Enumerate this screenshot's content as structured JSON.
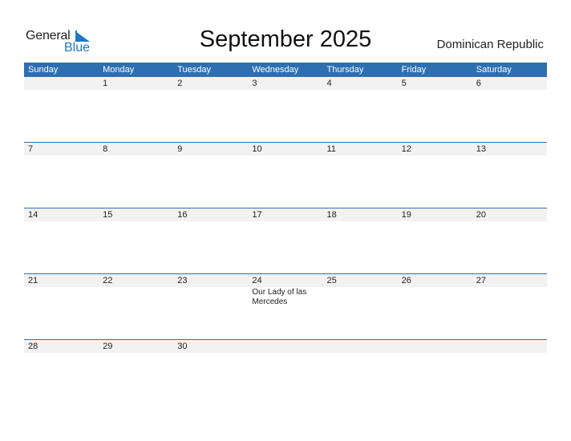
{
  "logo": {
    "word1": "General",
    "word2": "Blue"
  },
  "title": "September 2025",
  "country": "Dominican Republic",
  "weekdays": [
    "Sunday",
    "Monday",
    "Tuesday",
    "Wednesday",
    "Thursday",
    "Friday",
    "Saturday"
  ],
  "weeks": [
    {
      "days": [
        "",
        "1",
        "2",
        "3",
        "4",
        "5",
        "6"
      ],
      "events": [
        "",
        "",
        "",
        "",
        "",
        "",
        ""
      ]
    },
    {
      "days": [
        "7",
        "8",
        "9",
        "10",
        "11",
        "12",
        "13"
      ],
      "events": [
        "",
        "",
        "",
        "",
        "",
        "",
        ""
      ]
    },
    {
      "days": [
        "14",
        "15",
        "16",
        "17",
        "18",
        "19",
        "20"
      ],
      "events": [
        "",
        "",
        "",
        "",
        "",
        "",
        ""
      ]
    },
    {
      "days": [
        "21",
        "22",
        "23",
        "24",
        "25",
        "26",
        "27"
      ],
      "events": [
        "",
        "",
        "",
        "Our Lady of las Mercedes",
        "",
        "",
        ""
      ]
    },
    {
      "days": [
        "28",
        "29",
        "30",
        "",
        "",
        "",
        ""
      ],
      "events": [
        "",
        "",
        "",
        "",
        "",
        "",
        ""
      ]
    }
  ],
  "colors": {
    "accent": "#2e6fb0",
    "logo_blue": "#1f77c9",
    "day_band": "#f2f2f2"
  }
}
